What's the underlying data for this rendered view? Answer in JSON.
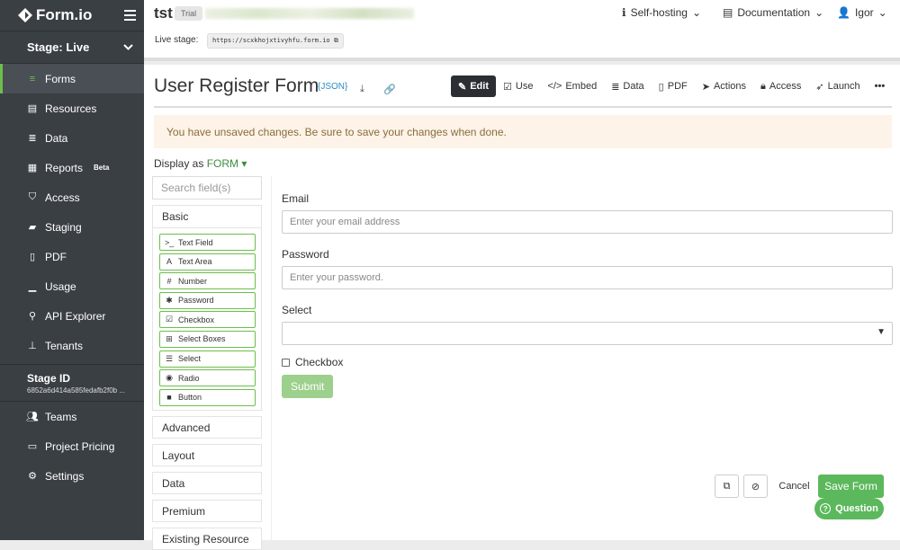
{
  "brand": {
    "name": "Form.io"
  },
  "stage": {
    "label": "Stage: Live"
  },
  "sidebar": {
    "items": [
      {
        "label": "Forms",
        "icon": "list-icon"
      },
      {
        "label": "Resources",
        "icon": "database-icon"
      },
      {
        "label": "Data",
        "icon": "data-icon"
      },
      {
        "label": "Reports",
        "icon": "reports-icon",
        "badge": "Beta"
      },
      {
        "label": "Access",
        "icon": "shield-icon"
      },
      {
        "label": "Staging",
        "icon": "folder-icon"
      },
      {
        "label": "PDF",
        "icon": "pdf-icon"
      },
      {
        "label": "Usage",
        "icon": "chart-icon"
      },
      {
        "label": "API Explorer",
        "icon": "pin-icon"
      },
      {
        "label": "Tenants",
        "icon": "sitemap-icon"
      }
    ],
    "stage_id": {
      "title": "Stage ID",
      "value": "6852a6d414a585fedafb2f0b ..."
    },
    "bottom": [
      {
        "label": "Teams",
        "icon": "users-icon"
      },
      {
        "label": "Project Pricing",
        "icon": "card-icon"
      },
      {
        "label": "Settings",
        "icon": "gear-icon"
      }
    ]
  },
  "topbar": {
    "project": "tst",
    "trial": "Trial",
    "live_stage_label": "Live stage:",
    "live_stage_url": "https://scxkhojxtivyhfu.form.io",
    "menu": [
      {
        "label": "Self-hosting",
        "icon": "info-icon"
      },
      {
        "label": "Documentation",
        "icon": "book-icon"
      },
      {
        "label": "Igor",
        "icon": "user-icon"
      }
    ]
  },
  "form": {
    "title": "User Register Form",
    "json_label": "{JSON}",
    "tabs": [
      "Edit",
      "Use",
      "Embed",
      "Data",
      "PDF",
      "Actions",
      "Access",
      "Launch"
    ],
    "more": "•••",
    "warning": "You have unsaved changes. Be sure to save your changes when done.",
    "display_label": "Display as",
    "display_value": "FORM"
  },
  "builder": {
    "search_placeholder": "Search field(s)",
    "basic_label": "Basic",
    "components": [
      {
        "label": "Text Field",
        "icon": ">_"
      },
      {
        "label": "Text Area",
        "icon": "A"
      },
      {
        "label": "Number",
        "icon": "#"
      },
      {
        "label": "Password",
        "icon": "✱"
      },
      {
        "label": "Checkbox",
        "icon": "☑"
      },
      {
        "label": "Select Boxes",
        "icon": "⊞"
      },
      {
        "label": "Select",
        "icon": "☰"
      },
      {
        "label": "Radio",
        "icon": "◉"
      },
      {
        "label": "Button",
        "icon": "■"
      }
    ],
    "groups": [
      "Advanced",
      "Layout",
      "Data",
      "Premium",
      "Existing Resource"
    ]
  },
  "canvas": {
    "email_label": "Email",
    "email_placeholder": "Enter your email address",
    "password_label": "Password",
    "password_placeholder": "Enter your password.",
    "select_label": "Select",
    "checkbox_label": "Checkbox",
    "submit_label": "Submit"
  },
  "actions": {
    "cancel": "Cancel",
    "save": "Save Form",
    "question": "Question"
  },
  "colors": {
    "accent": "#5cb85c",
    "sidebar": "#3a3f44",
    "warning_bg": "#fdf3e8"
  }
}
